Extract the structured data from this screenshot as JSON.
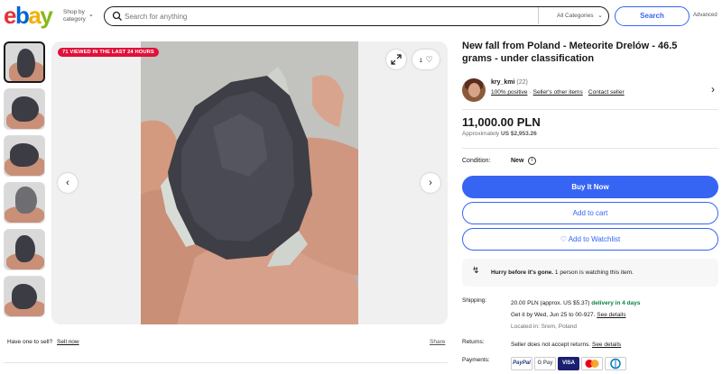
{
  "header": {
    "logo_letters": [
      {
        "ch": "e",
        "color": "#e53238"
      },
      {
        "ch": "b",
        "color": "#0064d2"
      },
      {
        "ch": "a",
        "color": "#f5af02"
      },
      {
        "ch": "y",
        "color": "#86b817"
      }
    ],
    "shop_by_category": "Shop by category",
    "search_placeholder": "Search for anything",
    "category_select": "All Categories",
    "search_button": "Search",
    "advanced": "Advanced"
  },
  "gallery": {
    "badge": "71 VIEWED IN THE LAST 24 HOURS",
    "favorite_count": "1",
    "thumbnail_count": 6
  },
  "below_gallery": {
    "sell_prompt": "Have one to sell?",
    "sell_now": "Sell now",
    "share": "Share"
  },
  "listing": {
    "title": "New fall from Poland - Meteorite Drelów - 46.5 grams - under classification",
    "seller": {
      "name": "kry_kmi",
      "feedback_count": "(22)",
      "positive": "100% positive",
      "other_items": "Seller's other items",
      "contact": "Contact seller"
    },
    "price": "11,000.00 PLN",
    "approx_label": "Approximately",
    "approx_value": "US $2,953.26",
    "condition_label": "Condition:",
    "condition_value": "New",
    "buy_now": "Buy It Now",
    "add_to_cart": "Add to cart",
    "add_to_watchlist": "Add to Watchlist",
    "hurry_bold": "Hurry before it's gone.",
    "hurry_text": "1 person is watching this item.",
    "shipping_label": "Shipping:",
    "shipping_cost": "20.00 PLN (approx. US $5.37)",
    "shipping_delivery": "delivery in 4 days",
    "shipping_getby": "Get it by Wed, Jun 25 to 00-927.",
    "see_details": "See details",
    "located_in": "Located in: Srem, Poland",
    "returns_label": "Returns:",
    "returns_text": "Seller does not accept returns.",
    "payments_label": "Payments:",
    "payment_methods": [
      "PayPal",
      "G Pay",
      "VISA",
      "MC",
      "D"
    ]
  },
  "colors": {
    "accent": "#3665f3",
    "badge": "#e0103a",
    "delivery_green": "#05823f"
  }
}
